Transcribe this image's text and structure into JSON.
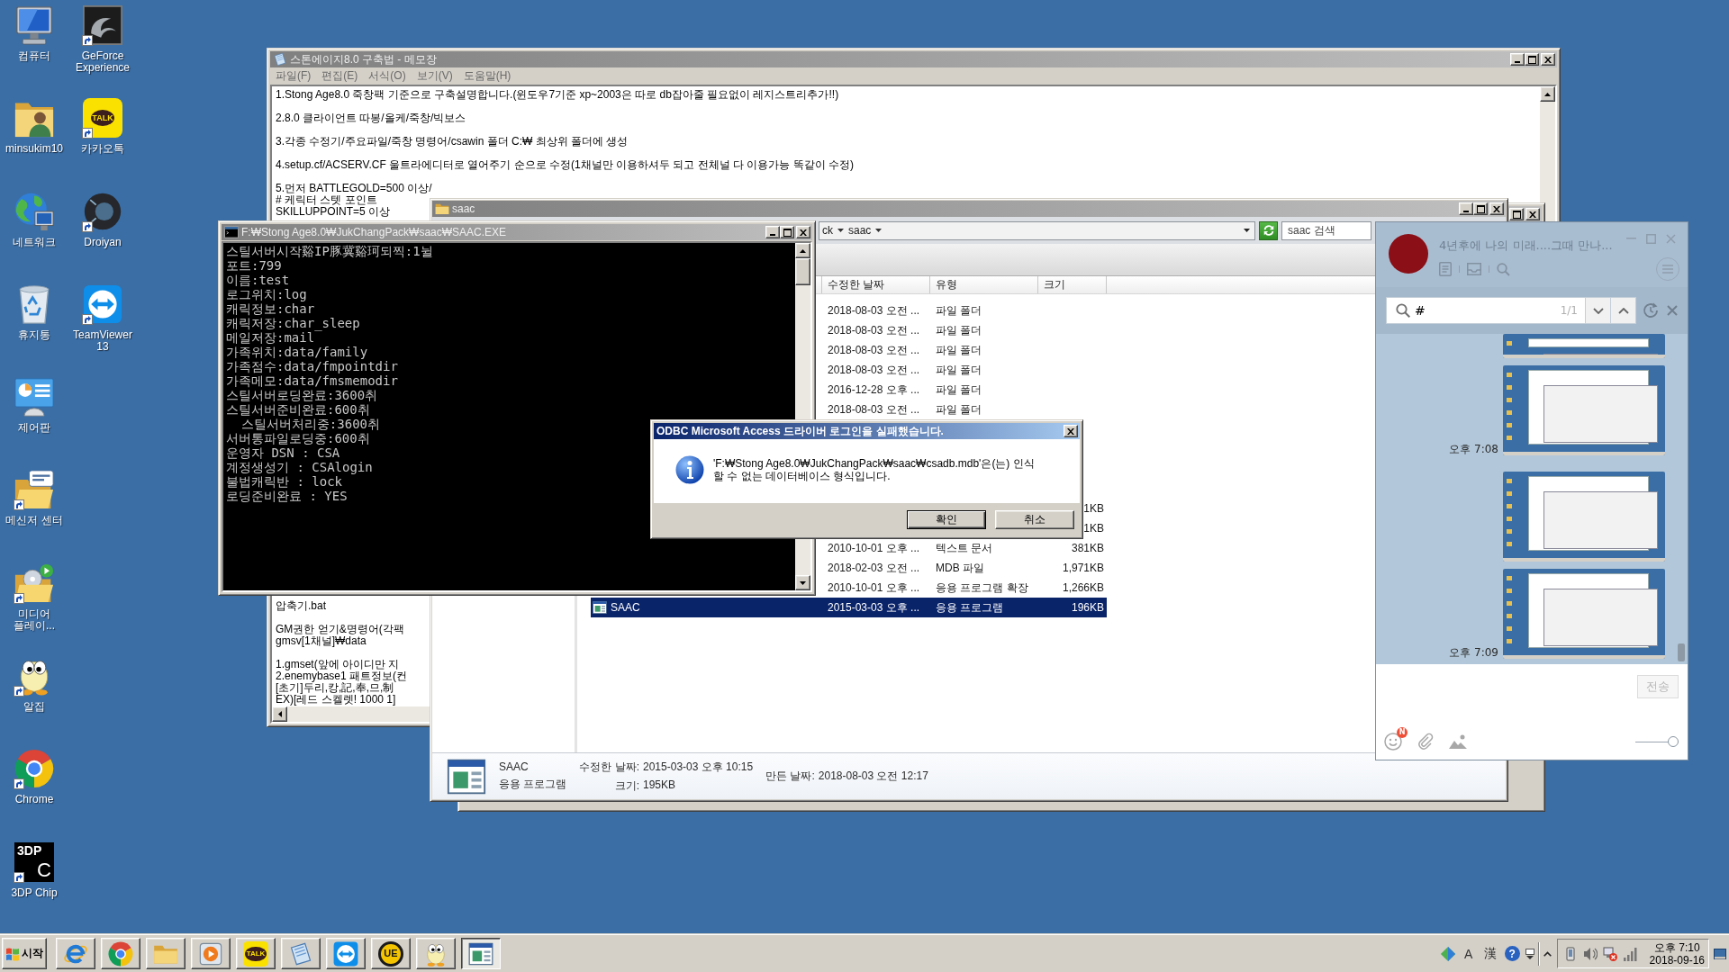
{
  "desktop_icons": [
    {
      "label": "컴퓨터",
      "kind": "computer",
      "shortcut": false
    },
    {
      "label": "minsukim10",
      "kind": "userfolder",
      "shortcut": false
    },
    {
      "label": "네트워크",
      "kind": "network",
      "shortcut": false
    },
    {
      "label": "휴지통",
      "kind": "recyclebin",
      "shortcut": false
    },
    {
      "label": "제어판",
      "kind": "controlpanel",
      "shortcut": false
    },
    {
      "label": "메신저 센터",
      "kind": "messenger",
      "shortcut": true
    },
    {
      "label": "미디어 플레이...",
      "kind": "mediafolder",
      "shortcut": true
    },
    {
      "label": "알집",
      "kind": "alzip",
      "shortcut": true
    },
    {
      "label": "Chrome",
      "kind": "chrome",
      "shortcut": true
    },
    {
      "label": "3DP Chip",
      "kind": "chip3dp",
      "logo_text": [
        "3DP",
        "C"
      ],
      "shortcut": true
    },
    {
      "label": "GeForce Experience",
      "kind": "geforce",
      "shortcut": true
    },
    {
      "label": "카카오톡",
      "kind": "kakao",
      "logo_text": [
        "TALK"
      ],
      "shortcut": true
    },
    {
      "label": "Droiyan",
      "kind": "droiyan",
      "shortcut": true
    },
    {
      "label": "TeamViewer 13",
      "kind": "teamviewer",
      "shortcut": true
    }
  ],
  "notepad": {
    "title": "스톤에이지8.0 구축법 - 메모장",
    "active": false,
    "menu": [
      "파일(F)",
      "편집(E)",
      "서식(O)",
      "보기(V)",
      "도움말(H)"
    ],
    "text_top": [
      [
        "1.Stong Age8.0 죽창팩 기준으로 구축설명합니다.(윈도우7기준 xp~2003은 따로 db잡아줄 필요없이 레지스트리추가!!)"
      ],
      [
        "2.8.0 클라이언트 따봉/올케/죽창/빅보스"
      ],
      [
        "3.각종 수정기/주요파일/죽창 명령어/csawin 폴더 C:₩ 최상위 폴더에 생성"
      ],
      [
        "4.setup.cf/ACSERV.CF 울트라에디터로 열어주기 순으로 수정(1채널만 이용하셔두 되고 전체널 다 이용가능 똑같이 수정)"
      ],
      [
        "5.먼저 BATTLEGOLD=500 이상/",
        "# 케릭터 스텟 포인트",
        "SKILLUPPOINT=5 이상"
      ]
    ],
    "text_bottom": [
      [
        "압축기.bat"
      ],
      [
        "GM권한 얻기&명령어(각팩",
        "gmsv[1채널]₩data"
      ],
      [
        "1.gmset(앞에 아이디만 지",
        "2.enemybase1 패트정보(컨",
        "[초기]두리,캉,記,奉,므,制",
        "EX)[레드 스켈렛! 1000 1]"
      ]
    ]
  },
  "background_window": {
    "active": false
  },
  "explorer": {
    "title": "saac",
    "active": false,
    "breadcrumb": [
      "ck",
      "saac"
    ],
    "search": {
      "placeholder": "saac 검색"
    },
    "columns": [
      "수정한 날짜",
      "유형",
      "크기"
    ],
    "rows": [
      {
        "date": "2018-08-03 오전 ...",
        "type": "파일 폴더",
        "selected": false
      },
      {
        "date": "2018-08-03 오전 ...",
        "type": "파일 폴더",
        "selected": false
      },
      {
        "date": "2018-08-03 오전 ...",
        "type": "파일 폴더",
        "selected": false
      },
      {
        "date": "2018-08-03 오전 ...",
        "type": "파일 폴더",
        "selected": false
      },
      {
        "date": "2016-12-28 오후 ...",
        "type": "파일 폴더",
        "selected": false
      },
      {
        "date": "2018-08-03 오전 ...",
        "type": "파일 폴더",
        "selected": false
      },
      {
        "size": "1KB",
        "selected": false
      },
      {
        "size": "1KB",
        "selected": false
      },
      {
        "date": "2010-10-01 오후 ...",
        "type": "텍스트 문서",
        "size": "381KB",
        "selected": false
      },
      {
        "date": "2018-02-03 오전 ...",
        "type": "MDB 파일",
        "size": "1,971KB",
        "selected": false
      },
      {
        "date": "2010-10-01 오후 ...",
        "type": "응용 프로그램 확장",
        "size": "1,266KB",
        "selected": false
      },
      {
        "name": "SAAC",
        "kind": "app",
        "date": "2015-03-03 오후 ...",
        "type": "응용 프로그램",
        "size": "196KB",
        "selected": true
      }
    ],
    "details": {
      "name": "SAAC",
      "type": "응용 프로그램",
      "kind": "app",
      "properties": [
        {
          "label": "수정한 날짜:",
          "value": "2015-03-03 오후 10:15"
        },
        {
          "label": "크기:",
          "value": "195KB"
        },
        {
          "label": "만든 날짜:",
          "value": "2018-08-03 오전 12:17"
        }
      ]
    }
  },
  "console": {
    "title": "F:₩Stong Age8.0₩JukChangPack₩saac₩SAAC.EXE",
    "active": false,
    "lines": [
      "스틸서버시작谿IP豚冀谿珂되찍:1뉠",
      "포트:799",
      "이름:test",
      "로그위치:log",
      "캐릭정보:char",
      "캐릭저장:char_sleep",
      "메일저장:mail",
      "가족위치:data/family",
      "가족점수:data/fmpointdir",
      "가족메모:data/fmsmemodir",
      "스틸서버로딩완료:3600취",
      "스틸서버준비완료:600취",
      "  스틸서버처리중:3600취",
      "서버통파일로딩중:600취",
      "운영자 DSN : CSA",
      "계정생성기 : CSAlogin",
      "불법캐릭반 : lock",
      "로딩준비완료 : YES"
    ]
  },
  "dialog": {
    "title": "ODBC Microsoft Access 드라이버 로그인을 실패했습니다.",
    "active": true,
    "message": "'F:₩Stong Age8.0₩JukChangPack₩saac₩csadb.mdb'은(는) 인식 할 수 없는 데이터베이스 형식입니다.",
    "buttons": [
      {
        "label": "확인",
        "default": true
      },
      {
        "label": "취소",
        "default": false
      }
    ]
  },
  "kakao": {
    "title": "4년후에 나의 미래....그때 만나...",
    "search": {
      "value": "#",
      "count": "1/1"
    },
    "messages": [
      {
        "kind": "image"
      },
      {
        "kind": "image",
        "time": "오후 7:08"
      },
      {
        "kind": "image"
      },
      {
        "kind": "image",
        "time": "오후 7:09"
      }
    ],
    "send": {
      "label": "전송",
      "disabled": true
    },
    "emoticon_badge": "N",
    "slider": {
      "level": 1
    }
  },
  "taskbar": {
    "start": "시작",
    "buttons": [
      {
        "kind": "ie",
        "selected": false
      },
      {
        "kind": "chrome",
        "selected": false
      },
      {
        "kind": "explorer",
        "selected": false
      },
      {
        "kind": "media",
        "selected": false
      },
      {
        "kind": "kakao",
        "logo_text": [
          "TALK"
        ],
        "selected": false
      },
      {
        "kind": "notepad",
        "selected": false
      },
      {
        "kind": "teamviewer",
        "selected": false
      },
      {
        "kind": "ultraedit",
        "logo_text": [
          "UE"
        ],
        "selected": false
      },
      {
        "kind": "alzip",
        "selected": false
      },
      {
        "kind": "app",
        "selected": true
      }
    ],
    "language": [
      "A",
      "漢"
    ],
    "help": "?",
    "clock": {
      "time": "오후 7:10",
      "date": "2018-09-16"
    }
  }
}
